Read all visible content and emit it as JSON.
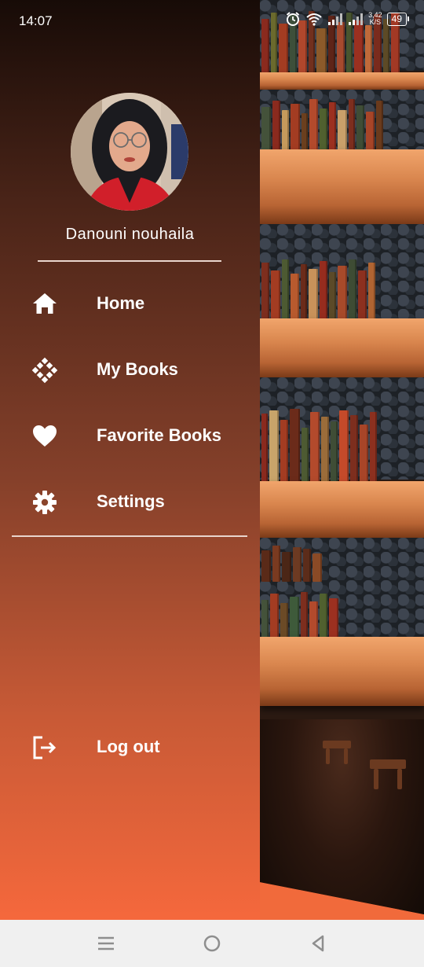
{
  "status_bar": {
    "time": "14:07",
    "speed_value": "3,42",
    "speed_unit": "K/S",
    "battery": "49"
  },
  "drawer": {
    "user_name": "Danouni nouhaila",
    "menu": [
      {
        "label": "Home",
        "icon": "home-icon"
      },
      {
        "label": "My Books",
        "icon": "books-grid-icon"
      },
      {
        "label": "Favorite Books",
        "icon": "heart-icon"
      },
      {
        "label": "Settings",
        "icon": "gear-icon"
      }
    ],
    "logout_label": "Log out"
  },
  "colors": {
    "drawer_top": "#170b07",
    "drawer_bottom": "#f5683c",
    "accent": "#f16a3b",
    "text": "#ffffff",
    "nav_bar": "#f0f0f0"
  }
}
